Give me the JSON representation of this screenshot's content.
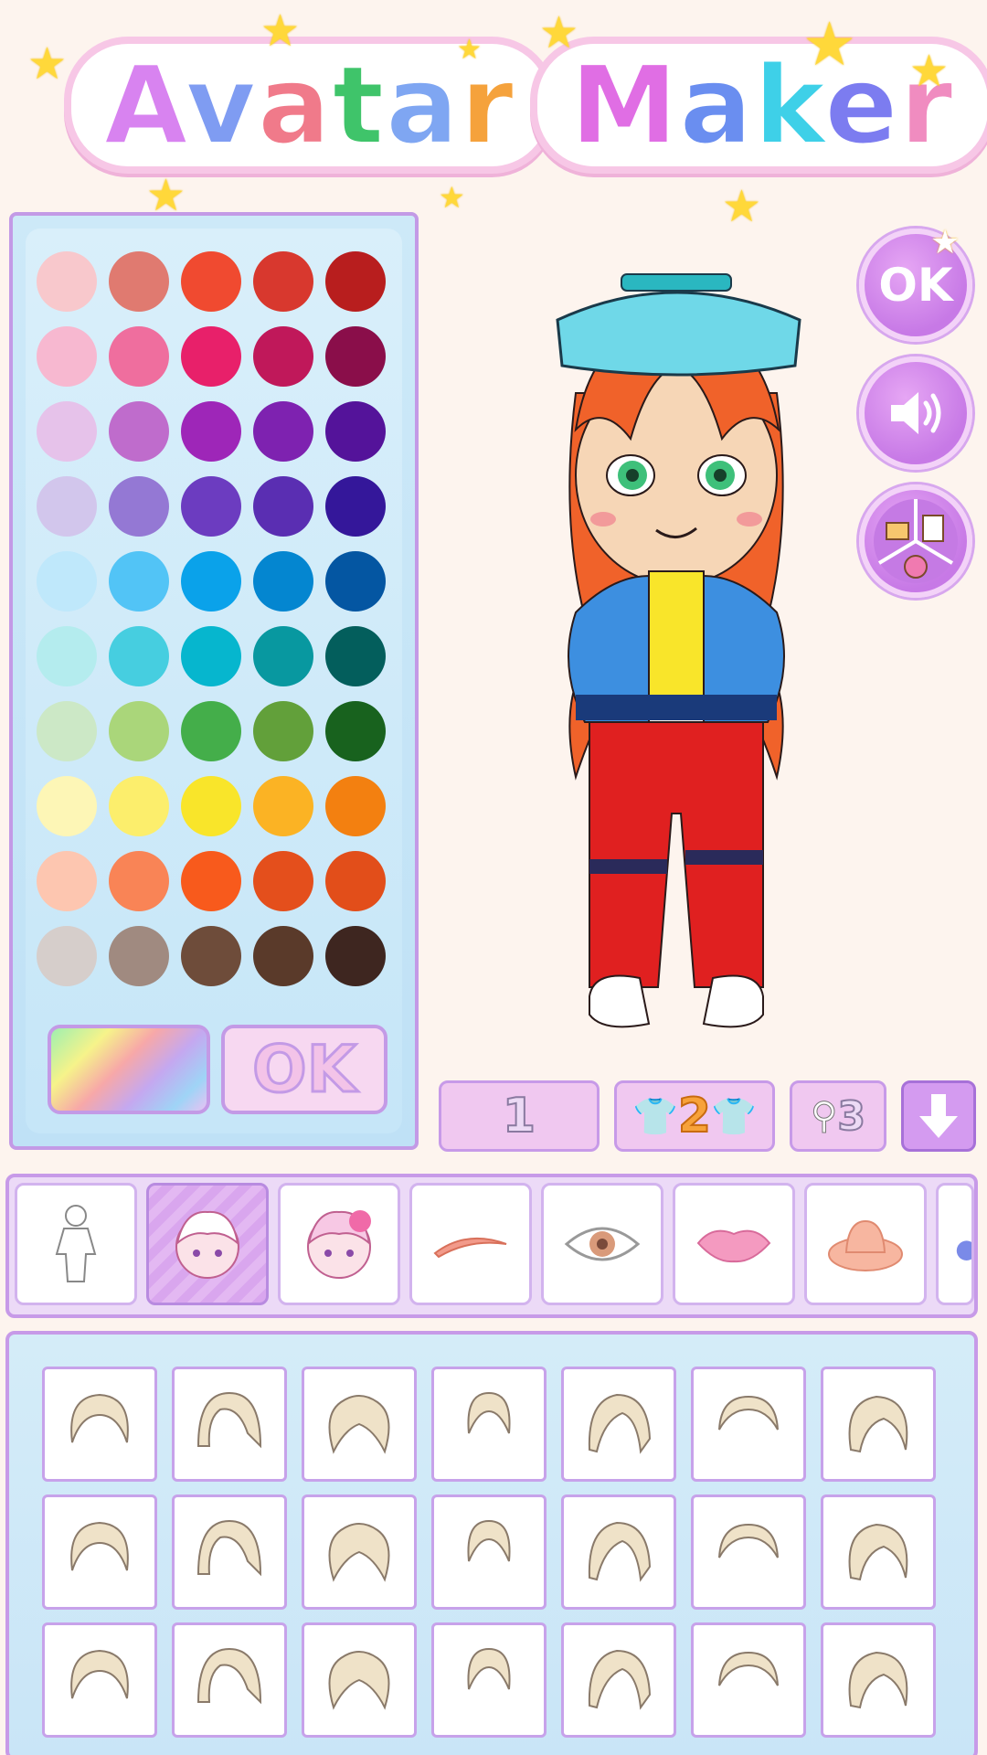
{
  "title": {
    "word1": "Avatar",
    "word2": "Maker"
  },
  "title_letter_colors": [
    "#d883f0",
    "#7f9cf2",
    "#f07a8a",
    "#3fc46a",
    "#7fa6f2",
    "#f5a23c",
    "#e06ee4",
    "#6a8ef0",
    "#3ed0e8",
    "#7c7cf0",
    "#f08cc0"
  ],
  "palette": {
    "rows": [
      [
        "#f8c8cc",
        "#e07a70",
        "#f04a30",
        "#d8382e",
        "#b81e1e"
      ],
      [
        "#f7b8d0",
        "#ef6e9e",
        "#e8206a",
        "#c0185a",
        "#8a0e4a"
      ],
      [
        "#e6c2ea",
        "#bf6ccc",
        "#9e26b8",
        "#7e22b0",
        "#54139a"
      ],
      [
        "#d2c6ec",
        "#9478d4",
        "#6c3cc0",
        "#5a2eb2",
        "#34179a"
      ],
      [
        "#bfe8fb",
        "#52c4f6",
        "#0aa2ea",
        "#0486d0",
        "#0456a2"
      ],
      [
        "#b4ecee",
        "#46cee0",
        "#06b6ce",
        "#0898a0",
        "#035e5c"
      ],
      [
        "#cce8c6",
        "#aad67a",
        "#44ae4a",
        "#62a03a",
        "#18621e"
      ],
      [
        "#fdf6b6",
        "#fcee6c",
        "#f9e52a",
        "#fbb324",
        "#f38010"
      ],
      [
        "#fdc6b0",
        "#f98456",
        "#f85a1c",
        "#e44f1c",
        "#e24e1a"
      ],
      [
        "#d6cecb",
        "#a08a80",
        "#6e4c3a",
        "#5a3a2a",
        "#3e2620"
      ]
    ],
    "ok_label": "OK"
  },
  "side_buttons": {
    "ok_label": "OK",
    "sound_icon": "speaker-icon",
    "menu_icon": "shop-menu-icon"
  },
  "options": {
    "opt1": "1",
    "opt2": "2",
    "opt3": "3"
  },
  "categories": [
    "body-icon",
    "hair-icon",
    "hair-accessory-icon",
    "eyebrow-icon",
    "eye-icon",
    "lips-icon",
    "hat-icon",
    "more-icon"
  ],
  "selected_category": "hair-icon",
  "colors": {
    "accent_purple": "#c79ae8",
    "panel_blue": "#cde9f8",
    "hair_fill": "#efe2c8",
    "hair_stroke": "#8a7a6a"
  }
}
